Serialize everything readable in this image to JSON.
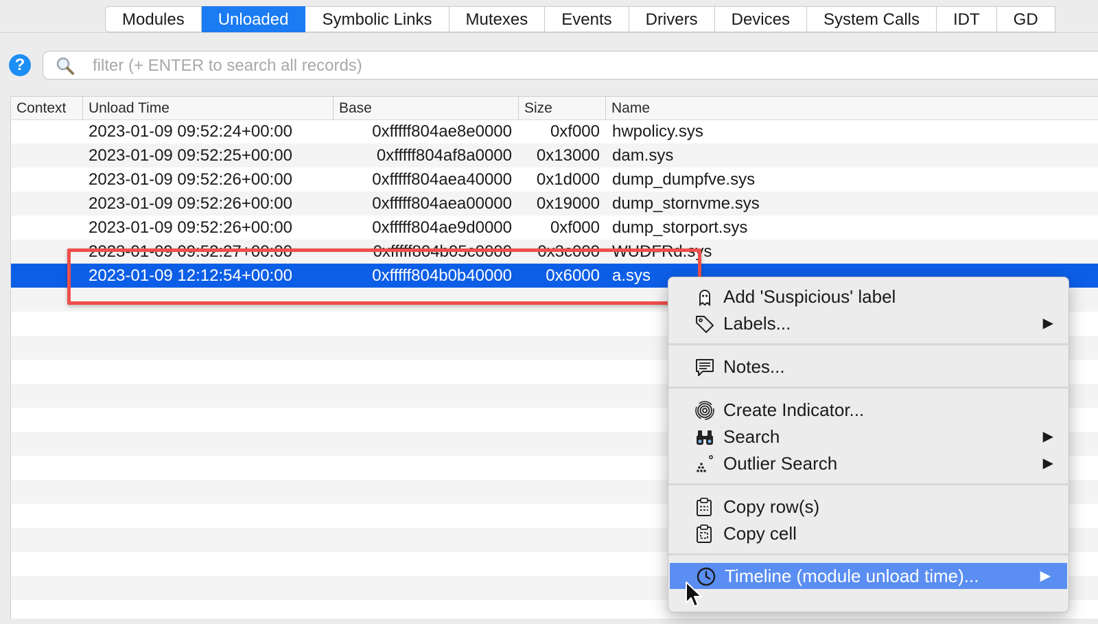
{
  "tabs": [
    "Modules",
    "Unloaded",
    "Symbolic Links",
    "Mutexes",
    "Events",
    "Drivers",
    "Devices",
    "System Calls",
    "IDT",
    "GD"
  ],
  "active_tab": "Unloaded",
  "help_label": "?",
  "filter": {
    "placeholder": "filter (+ ENTER to search all records)"
  },
  "columns": {
    "context": "Context",
    "unload_time": "Unload Time",
    "base": "Base",
    "size": "Size",
    "name": "Name"
  },
  "rows": [
    {
      "time": "2023-01-09 09:52:24+00:00",
      "base": "0xfffff804ae8e0000",
      "size": "0xf000",
      "name": "hwpolicy.sys"
    },
    {
      "time": "2023-01-09 09:52:25+00:00",
      "base": "0xfffff804af8a0000",
      "size": "0x13000",
      "name": "dam.sys"
    },
    {
      "time": "2023-01-09 09:52:26+00:00",
      "base": "0xfffff804aea40000",
      "size": "0x1d000",
      "name": "dump_dumpfve.sys"
    },
    {
      "time": "2023-01-09 09:52:26+00:00",
      "base": "0xfffff804aea00000",
      "size": "0x19000",
      "name": "dump_stornvme.sys"
    },
    {
      "time": "2023-01-09 09:52:26+00:00",
      "base": "0xfffff804ae9d0000",
      "size": "0xf000",
      "name": "dump_storport.sys"
    },
    {
      "time": "2023-01-09 09:52:27+00:00",
      "base": "0xfffff804b05c0000",
      "size": "0x3c000",
      "name": "WUDFRd.sys"
    },
    {
      "time": "2023-01-09 12:12:54+00:00",
      "base": "0xfffff804b0b40000",
      "size": "0x6000",
      "name": "a.sys",
      "selected": true
    }
  ],
  "menu": {
    "add_suspicious": "Add 'Suspicious' label",
    "labels": "Labels...",
    "notes": "Notes...",
    "create_indicator": "Create Indicator...",
    "search": "Search",
    "outlier_search": "Outlier Search",
    "copy_rows": "Copy row(s)",
    "copy_cell": "Copy cell",
    "timeline": "Timeline (module unload time)...",
    "submenu_arrow": "▶"
  },
  "colors": {
    "selection": "#0d5ee6",
    "tab_active": "#1b7bf2",
    "highlight_box": "#ef4f4a",
    "menu_hover": "#5a8ef2"
  }
}
